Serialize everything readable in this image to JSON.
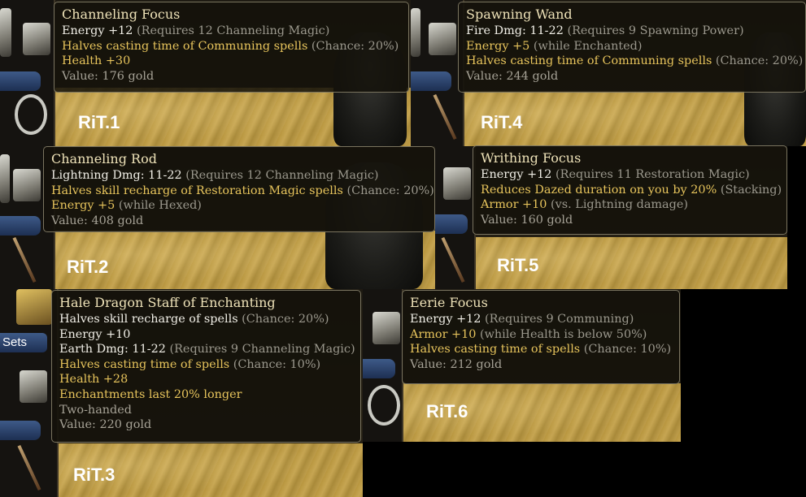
{
  "panels": [
    {
      "label": "RiT.1",
      "title": "Channeling Focus",
      "lines": [
        {
          "text": "Energy +12",
          "req": "(Requires 12 Channeling Magic)",
          "color": "white"
        },
        {
          "text": "Halves casting time of Communing spells",
          "req": "(Chance: 20%)",
          "color": "gold"
        },
        {
          "text": "Health +30",
          "req": "",
          "color": "gold"
        },
        {
          "text": "Value: 176 gold",
          "req": "",
          "color": "grey"
        }
      ]
    },
    {
      "label": "RiT.4",
      "title": "Spawning Wand",
      "lines": [
        {
          "text": "Fire Dmg: 11-22",
          "req": "(Requires 9 Spawning Power)",
          "color": "white"
        },
        {
          "text": "Energy +5",
          "req": "(while Enchanted)",
          "color": "gold"
        },
        {
          "text": "Halves casting time of Communing spells",
          "req": "(Chance: 20%)",
          "color": "gold"
        },
        {
          "text": "Value: 244 gold",
          "req": "",
          "color": "grey"
        }
      ]
    },
    {
      "label": "RiT.2",
      "title": "Channeling Rod",
      "lines": [
        {
          "text": "Lightning Dmg: 11-22",
          "req": "(Requires 12 Channeling Magic)",
          "color": "white"
        },
        {
          "text": "Halves skill recharge of Restoration Magic spells",
          "req": "(Chance: 20%)",
          "color": "gold"
        },
        {
          "text": "Energy +5",
          "req": "(while Hexed)",
          "color": "gold"
        },
        {
          "text": "Value: 408 gold",
          "req": "",
          "color": "grey"
        }
      ]
    },
    {
      "label": "RiT.5",
      "title": "Writhing Focus",
      "lines": [
        {
          "text": "Energy +12",
          "req": "(Requires 11 Restoration Magic)",
          "color": "white"
        },
        {
          "text": "Reduces Dazed duration on you by 20%",
          "req": "(Stacking)",
          "color": "gold"
        },
        {
          "text": "Armor +10",
          "req": "(vs. Lightning damage)",
          "color": "gold"
        },
        {
          "text": "Value: 160 gold",
          "req": "",
          "color": "grey"
        }
      ]
    },
    {
      "label": "RiT.3",
      "title": "Hale Dragon Staff of Enchanting",
      "lines": [
        {
          "text": "Halves skill recharge of spells",
          "req": "(Chance: 20%)",
          "color": "white"
        },
        {
          "text": "Energy +10",
          "req": "",
          "color": "white"
        },
        {
          "text": "Earth Dmg: 11-22",
          "req": "(Requires 9 Channeling Magic)",
          "color": "white"
        },
        {
          "text": "Halves casting time of spells",
          "req": "(Chance: 10%)",
          "color": "gold"
        },
        {
          "text": "Health +28",
          "req": "",
          "color": "gold"
        },
        {
          "text": "Enchantments last 20% longer",
          "req": "",
          "color": "gold"
        },
        {
          "text": "Two-handed",
          "req": "",
          "color": "grey"
        },
        {
          "text": "Value: 220 gold",
          "req": "",
          "color": "grey"
        }
      ]
    },
    {
      "label": "RiT.6",
      "title": "Eerie Focus",
      "lines": [
        {
          "text": "Energy +12",
          "req": "(Requires 9 Communing)",
          "color": "white"
        },
        {
          "text": "Armor +10",
          "req": "(while Health is below 50%)",
          "color": "gold"
        },
        {
          "text": "Halves casting time of spells",
          "req": "(Chance: 10%)",
          "color": "gold"
        },
        {
          "text": "Value: 212 gold",
          "req": "",
          "color": "grey"
        }
      ]
    }
  ],
  "sets_tab": "Sets",
  "icons": [
    "shield-icon",
    "gauntlet-icon",
    "amulet-icon",
    "staff-icon",
    "wand-icon"
  ],
  "colors": {
    "white": "#f1efe7",
    "gold": "#e7c45c",
    "grey": "#a6a296",
    "req": "#9b988d",
    "title": "#eee2b8"
  }
}
